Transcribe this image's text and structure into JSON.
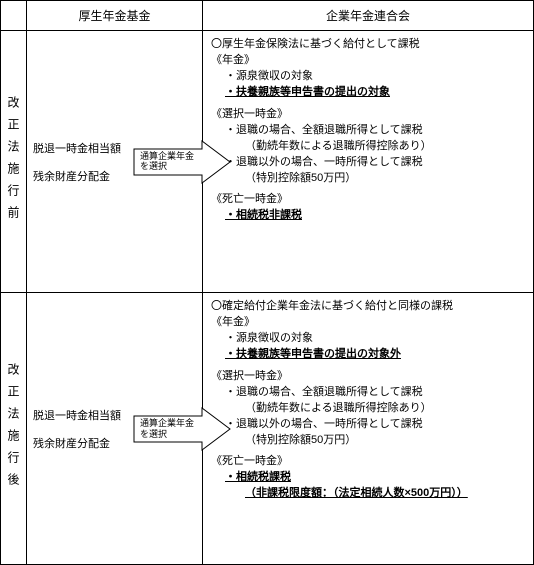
{
  "header": {
    "col1": "厚生年金基金",
    "col2": "企業年金連合会"
  },
  "rows": [
    {
      "label": "改正法施行前",
      "left": {
        "item1": "脱退一時金相当額",
        "item2": "残余財産分配金",
        "arrow_text": "通算企業年金を選択"
      },
      "right": {
        "head": "厚生年金保険法に基づく給付として課税",
        "g1_title": "年金",
        "g1_b1": "源泉徴収の対象",
        "g1_b2": "扶養親族等申告書の提出の対象",
        "g2_title": "選択一時金",
        "g2_b1": "退職の場合、全額退職所得として課税",
        "g2_b1_note": "（勤続年数による退職所得控除あり）",
        "g2_b2": "退職以外の場合、一時所得として課税",
        "g2_b2_note": "（特別控除額50万円）",
        "g3_title": "死亡一時金",
        "g3_b1": "相続税非課税"
      }
    },
    {
      "label": "改正法施行後",
      "left": {
        "item1": "脱退一時金相当額",
        "item2": "残余財産分配金",
        "arrow_text": "通算企業年金を選択"
      },
      "right": {
        "head": "確定給付企業年金法に基づく給付と同様の課税",
        "g1_title": "年金",
        "g1_b1": "源泉徴収の対象",
        "g1_b2": "扶養親族等申告書の提出の対象外",
        "g2_title": "選択一時金",
        "g2_b1": "退職の場合、全額退職所得として課税",
        "g2_b1_note": "（勤続年数による退職所得控除あり）",
        "g2_b2": "退職以外の場合、一時所得として課税",
        "g2_b2_note": "（特別控除額50万円）",
        "g3_title": "死亡一時金",
        "g3_b1": "相続税課税",
        "g3_b1_note": "（非課税限度額：（法定相続人数×500万円））"
      }
    }
  ]
}
